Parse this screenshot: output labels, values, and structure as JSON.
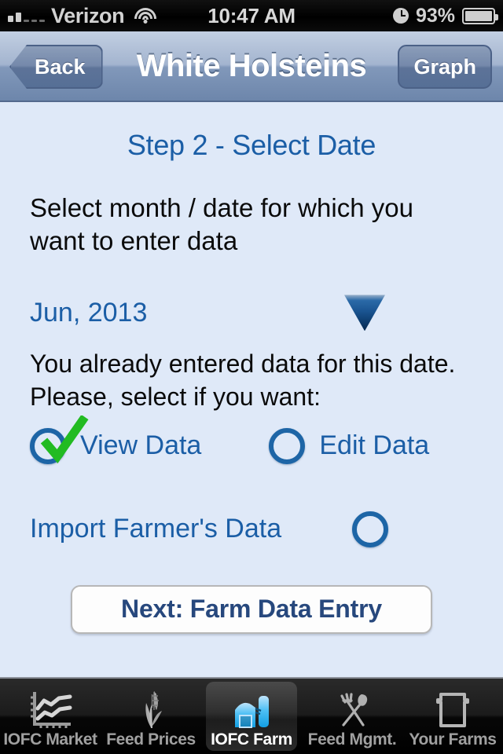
{
  "status_bar": {
    "carrier": "Verizon",
    "time": "10:47 AM",
    "battery_percent": "93%",
    "signal_icon": "signal-bars-icon",
    "wifi_icon": "wifi-icon",
    "alarm_icon": "alarm-clock-icon",
    "battery_icon": "battery-icon"
  },
  "nav_bar": {
    "back_label": "Back",
    "title": "White Holsteins",
    "right_label": "Graph"
  },
  "content": {
    "step_title": "Step 2 - Select Date",
    "instruction": "Select month / date for which you want to enter data",
    "date_value": "Jun, 2013",
    "dropdown_icon": "chevron-down-icon",
    "prompt_line1": "You already entered data for this date.",
    "prompt_line2": "Please, select if you want:",
    "options": [
      {
        "label": "View Data",
        "selected": true
      },
      {
        "label": "Edit Data",
        "selected": false
      }
    ],
    "import_label": "Import Farmer's Data",
    "import_selected": false,
    "next_button": "Next: Farm Data Entry"
  },
  "tab_bar": {
    "tabs": [
      {
        "label": "IOFC Market",
        "icon": "line-chart-icon",
        "active": false
      },
      {
        "label": "Feed Prices",
        "icon": "corn-stalk-icon",
        "active": false
      },
      {
        "label": "IOFC Farm",
        "icon": "barn-silo-icon",
        "active": true
      },
      {
        "label": "Feed Mgmt.",
        "icon": "fork-shovel-icon",
        "active": false
      },
      {
        "label": "Your Farms",
        "icon": "barn-outline-icon",
        "active": false
      }
    ]
  },
  "colors": {
    "content_bg": "#dfe9f8",
    "accent_blue": "#1b5ea6",
    "check_green": "#22bb22",
    "button_text": "#27487d",
    "navbar_top": "#c2cfe2",
    "navbar_bottom": "#6d86ab"
  }
}
